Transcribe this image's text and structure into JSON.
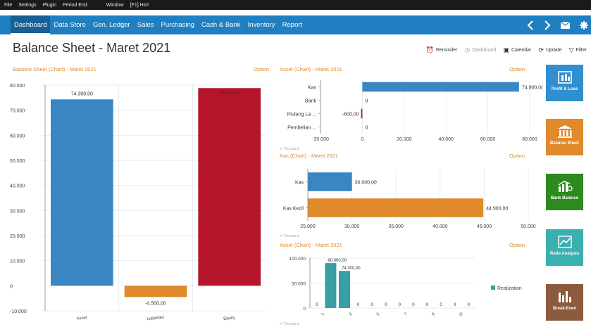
{
  "menu": [
    "File",
    "Settings",
    "Plugin",
    "Period End",
    "Window",
    "[F1] Hint"
  ],
  "nav": {
    "items": [
      "Dashboard",
      "Data Store",
      "Gen. Ledger",
      "Sales",
      "Purchasing",
      "Cash & Bank",
      "Inventory",
      "Report"
    ],
    "active": "Dashboard",
    "icons": [
      "chevron-left-icon",
      "chevron-right-icon",
      "mail-icon",
      "gear-icon"
    ]
  },
  "page": {
    "title": "Balance Sheet - Maret 2021"
  },
  "toolbar": {
    "reminder": "Reminder",
    "dashboard": "Dashboard",
    "calendar": "Calendar",
    "update": "Update",
    "filter": "Filter"
  },
  "panels": {
    "balance": {
      "title": "Balance Sheet (Chart) - Maret 2021",
      "option": "Option"
    },
    "asset": {
      "title": "Asset (Chart) - Maret 2021",
      "option": "Option",
      "unit": "In Thousand"
    },
    "kas": {
      "title": "Kas (Chart) - Maret 2021",
      "option": "Option",
      "unit": "In Thousand"
    },
    "asset2": {
      "title": "Asset (Chart) - Maret 2021",
      "option": "Option",
      "unit": "In Thousand"
    }
  },
  "tiles": [
    {
      "label": "Profit & Loss",
      "color": "#2f8fd0",
      "icon": "chart-money-icon"
    },
    {
      "label": "Balance Sheet",
      "color": "#e08a2c",
      "icon": "bank-icon"
    },
    {
      "label": "Bank Balance",
      "color": "#2d8a1f",
      "icon": "bank-growth-icon"
    },
    {
      "label": "Ratio Analysis",
      "color": "#3bb0b0",
      "icon": "ratio-chart-icon"
    },
    {
      "label": "Break-Even",
      "color": "#8c5a3c",
      "icon": "bar-chart-icon"
    }
  ],
  "chart_data": [
    {
      "type": "bar",
      "categories": [
        "Asset",
        "Liabilities",
        "Equity"
      ],
      "values": [
        74300,
        -4500,
        78800
      ],
      "labels": [
        "74.300,00",
        "-4.500,00",
        "78.800,00"
      ],
      "colors": [
        "#3a86c3",
        "#e08a2c",
        "#b5152b"
      ],
      "ylim": [
        -10000,
        80000
      ],
      "yticks": [
        "-10.000",
        "0",
        "10.000",
        "20.000",
        "30.000",
        "40.000",
        "50.000",
        "60.000",
        "70.000",
        "80.000"
      ]
    },
    {
      "type": "bar",
      "orientation": "horizontal",
      "categories": [
        "Kas",
        "Bank",
        "Piutang La ...",
        "Pembelian ..."
      ],
      "values": [
        74900,
        0,
        -600,
        0
      ],
      "labels": [
        "74.900,0(",
        "0",
        "-600,00",
        "0"
      ],
      "colors": [
        "#3a86c3",
        "#3a86c3",
        "#b5152b",
        "#3a86c3"
      ],
      "xlim": [
        -20000,
        80000
      ],
      "xticks": [
        "-20.000",
        "0",
        "20.000",
        "40.000",
        "60.000",
        "80.000"
      ]
    },
    {
      "type": "bar",
      "orientation": "horizontal",
      "categories": [
        "Kas",
        "Kas Kecil"
      ],
      "values": [
        30000,
        44900
      ],
      "labels": [
        "30.000,00",
        "44.900,00"
      ],
      "colors": [
        "#3a86c3",
        "#e08a2c"
      ],
      "xlim": [
        25000,
        50000
      ],
      "xticks": [
        "25.000",
        "30.000",
        "35.000",
        "40.000",
        "45.000",
        "50.000"
      ]
    },
    {
      "type": "bar",
      "categories": [
        "1",
        "2",
        "3",
        "4",
        "5",
        "6",
        "7",
        "8",
        "9",
        "10",
        "11",
        "12"
      ],
      "values": [
        0,
        90000,
        74300,
        0,
        0,
        0,
        0,
        0,
        0,
        0,
        0,
        0
      ],
      "labels": [
        "0",
        "90.000,00",
        "74.300,00",
        "0",
        "0",
        "0",
        "0",
        "0",
        "0",
        "0",
        "0",
        "0"
      ],
      "xticklabels": [
        "1",
        "3",
        "5",
        "7",
        "9",
        "11"
      ],
      "ylim": [
        0,
        100000
      ],
      "yticks": [
        "0",
        "50.000",
        "100.000"
      ],
      "series": [
        {
          "name": "Realization",
          "color": "#3a9ea5"
        }
      ]
    }
  ]
}
